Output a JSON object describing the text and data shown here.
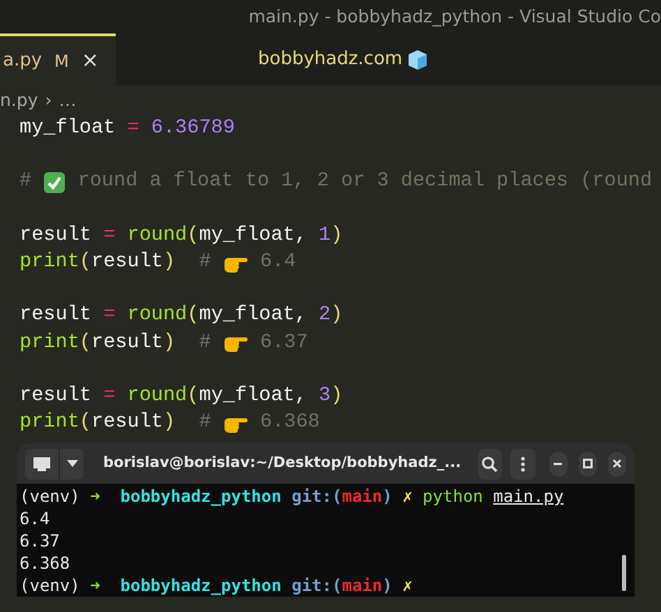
{
  "window": {
    "title": "main.py - bobbyhadz_python - Visual Studio Co"
  },
  "tab": {
    "label": "a.py",
    "badge": "M",
    "close": "×",
    "selected": true
  },
  "watermark_text": "bobbyhadz.com",
  "breadcrumb": [
    "n.py",
    "›",
    "…"
  ],
  "code_lines": [
    {
      "tokens": [
        {
          "kind": "var",
          "text": "my_float "
        },
        {
          "kind": "op",
          "text": "= "
        },
        {
          "kind": "num",
          "text": "6.36789"
        }
      ]
    },
    {
      "gap_before": true,
      "tokens": [
        {
          "kind": "comment",
          "text": "# "
        },
        {
          "kind": "check_emoji"
        },
        {
          "kind": "comment",
          "text": " round a float to 1, 2 or 3 decimal places (round"
        }
      ]
    },
    {
      "gap_before": true,
      "tokens": [
        {
          "kind": "var",
          "text": "result "
        },
        {
          "kind": "op",
          "text": "= "
        },
        {
          "kind": "func",
          "text": "round"
        },
        {
          "kind": "paren",
          "text": "("
        },
        {
          "kind": "var",
          "text": "my_float, "
        },
        {
          "kind": "num",
          "text": "1"
        },
        {
          "kind": "paren",
          "text": ")"
        }
      ]
    },
    {
      "tokens": [
        {
          "kind": "func",
          "text": "print"
        },
        {
          "kind": "paren",
          "text": "("
        },
        {
          "kind": "var",
          "text": "result"
        },
        {
          "kind": "paren",
          "text": ")"
        },
        {
          "kind": "comment",
          "text": "  # "
        },
        {
          "kind": "hand_emoji"
        },
        {
          "kind": "comment",
          "text": " 6.4"
        }
      ]
    },
    {
      "gap_before": true,
      "tokens": [
        {
          "kind": "var",
          "text": "result "
        },
        {
          "kind": "op",
          "text": "= "
        },
        {
          "kind": "func",
          "text": "round"
        },
        {
          "kind": "paren",
          "text": "("
        },
        {
          "kind": "var",
          "text": "my_float, "
        },
        {
          "kind": "num",
          "text": "2"
        },
        {
          "kind": "paren",
          "text": ")"
        }
      ]
    },
    {
      "tokens": [
        {
          "kind": "func",
          "text": "print"
        },
        {
          "kind": "paren",
          "text": "("
        },
        {
          "kind": "var",
          "text": "result"
        },
        {
          "kind": "paren",
          "text": ")"
        },
        {
          "kind": "comment",
          "text": "  # "
        },
        {
          "kind": "hand_emoji"
        },
        {
          "kind": "comment",
          "text": " 6.37"
        }
      ]
    },
    {
      "gap_before": true,
      "tokens": [
        {
          "kind": "var",
          "text": "result "
        },
        {
          "kind": "op",
          "text": "= "
        },
        {
          "kind": "func",
          "text": "round"
        },
        {
          "kind": "paren",
          "text": "("
        },
        {
          "kind": "var",
          "text": "my_float, "
        },
        {
          "kind": "num",
          "text": "3"
        },
        {
          "kind": "paren",
          "text": ")"
        }
      ]
    },
    {
      "tokens": [
        {
          "kind": "func",
          "text": "print"
        },
        {
          "kind": "paren",
          "text": "("
        },
        {
          "kind": "var",
          "text": "result"
        },
        {
          "kind": "paren",
          "text": ")"
        },
        {
          "kind": "comment",
          "text": "  # "
        },
        {
          "kind": "hand_emoji"
        },
        {
          "kind": "comment",
          "text": " 6.368"
        }
      ]
    }
  ],
  "terminal": {
    "title": "borislav@borislav:~/Desktop/bobbyhadz_...",
    "lines": [
      [
        {
          "kind": "plain",
          "text": "(venv) "
        },
        {
          "kind": "arrow",
          "text": "➜"
        },
        {
          "kind": "dir",
          "text": "  bobbyhadz_python "
        },
        {
          "kind": "git",
          "text": "git:("
        },
        {
          "kind": "branch",
          "text": "main"
        },
        {
          "kind": "git",
          "text": ")"
        },
        {
          "kind": "dirty",
          "text": " ✗ "
        },
        {
          "kind": "cmd",
          "text": "python "
        },
        {
          "kind": "link",
          "text": "main.py"
        }
      ],
      [
        {
          "kind": "plain",
          "text": "6.4"
        }
      ],
      [
        {
          "kind": "plain",
          "text": "6.37"
        }
      ],
      [
        {
          "kind": "plain",
          "text": "6.368"
        }
      ],
      [
        {
          "kind": "plain",
          "text": "(venv) "
        },
        {
          "kind": "arrow",
          "text": "➜"
        },
        {
          "kind": "dir",
          "text": "  bobbyhadz_python "
        },
        {
          "kind": "git",
          "text": "git:("
        },
        {
          "kind": "branch",
          "text": "main"
        },
        {
          "kind": "git",
          "text": ")"
        },
        {
          "kind": "dirty",
          "text": " ✗"
        }
      ]
    ]
  }
}
